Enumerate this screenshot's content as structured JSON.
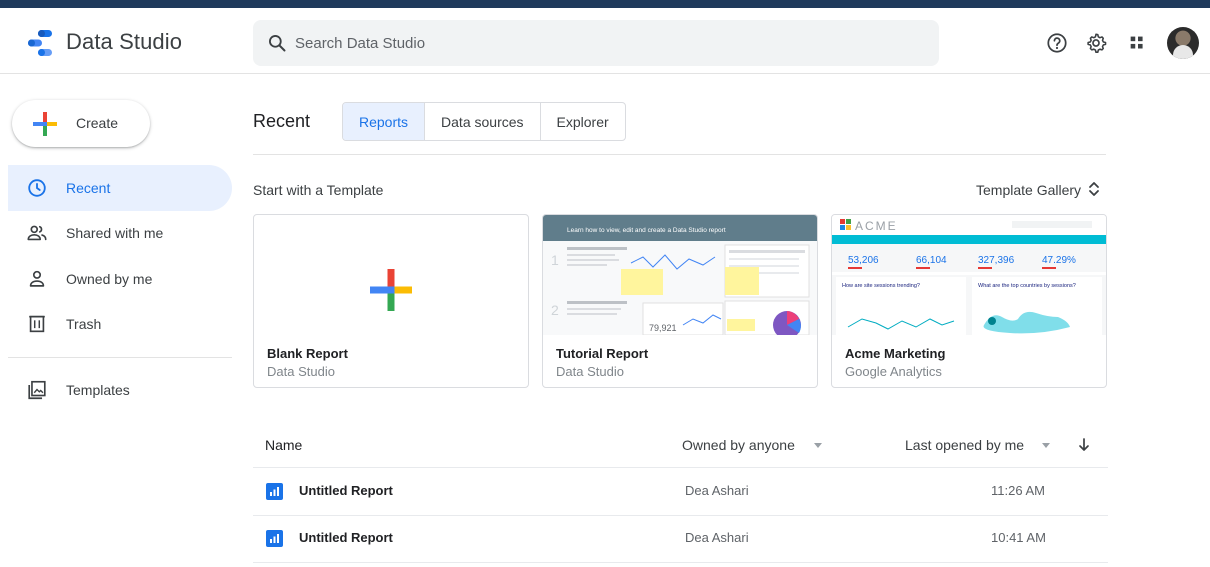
{
  "header": {
    "app_title": "Data Studio",
    "search_placeholder": "Search Data Studio",
    "icons": [
      "data-studio-logo",
      "search-icon",
      "help-icon",
      "settings-icon",
      "apps-grid-icon",
      "user-avatar"
    ]
  },
  "sidebar": {
    "create_label": "Create",
    "items": [
      {
        "label": "Recent",
        "icon": "clock-icon",
        "active": true
      },
      {
        "label": "Shared with me",
        "icon": "people-icon",
        "active": false
      },
      {
        "label": "Owned by me",
        "icon": "person-icon",
        "active": false
      },
      {
        "label": "Trash",
        "icon": "trash-icon",
        "active": false
      },
      {
        "label": "Templates",
        "icon": "templates-icon",
        "active": false
      }
    ]
  },
  "main": {
    "title": "Recent",
    "tabs": [
      {
        "label": "Reports",
        "active": true
      },
      {
        "label": "Data sources",
        "active": false
      },
      {
        "label": "Explorer",
        "active": false
      }
    ],
    "templates": {
      "section_title": "Start with a Template",
      "gallery_label": "Template Gallery",
      "cards": [
        {
          "title": "Blank Report",
          "subtitle": "Data Studio"
        },
        {
          "title": "Tutorial Report",
          "subtitle": "Data Studio",
          "thumb": {
            "heading": "Learn how to view, edit and create a Data Studio report",
            "step1": "1",
            "step2": "2",
            "metric": "79,921"
          }
        },
        {
          "title": "Acme Marketing",
          "subtitle": "Google Analytics",
          "thumb": {
            "brand": "ACME",
            "stats": [
              "53,206",
              "66,104",
              "327,396",
              "47.29%"
            ],
            "q1": "How are site sessions trending?",
            "q2": "What are the top countries by sessions?"
          }
        }
      ]
    },
    "table": {
      "headers": {
        "name": "Name",
        "owner": "Owned by anyone",
        "last": "Last opened by me"
      },
      "rows": [
        {
          "name": "Untitled Report",
          "owner": "Dea Ashari",
          "time": "11:26 AM"
        },
        {
          "name": "Untitled Report",
          "owner": "Dea Ashari",
          "time": "10:41 AM"
        }
      ]
    }
  },
  "colors": {
    "accent_blue": "#1a73e8",
    "active_bg": "#e8f0fe",
    "top_strip": "#1f3a5c",
    "google_red": "#ea4335",
    "google_yellow": "#fbbc04",
    "google_green": "#34a853",
    "google_blue": "#4285f4",
    "acme_teal": "#00bcd4"
  }
}
